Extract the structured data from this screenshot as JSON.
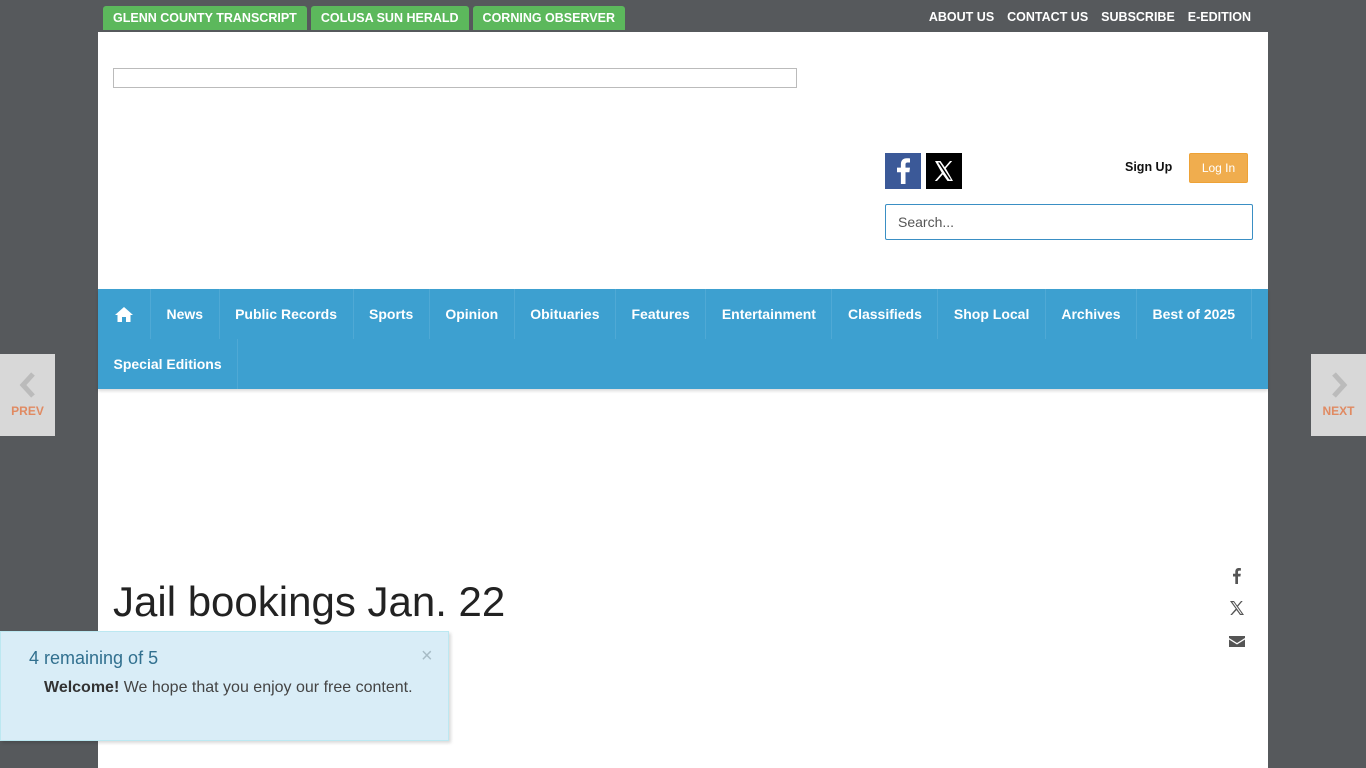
{
  "topbar": {
    "sister_sites": [
      "GLENN COUNTY TRANSCRIPT",
      "COLUSA SUN HERALD",
      "CORNING OBSERVER"
    ],
    "links": [
      "ABOUT US",
      "CONTACT US",
      "SUBSCRIBE",
      "E-EDITION"
    ]
  },
  "header": {
    "signup_label": "Sign Up",
    "login_label": "Log In",
    "search_placeholder": "Search..."
  },
  "nav": {
    "items": [
      "News",
      "Public Records",
      "Sports",
      "Opinion",
      "Obituaries",
      "Features",
      "Entertainment",
      "Classifieds",
      "Shop Local",
      "Archives",
      "Best of 2025"
    ],
    "items_row2": [
      "Special Editions"
    ]
  },
  "article": {
    "headline": "Jail bookings Jan. 22"
  },
  "side_nav": {
    "prev_label": "PREV",
    "next_label": "NEXT"
  },
  "notice": {
    "title": "4 remaining of 5",
    "close": "×",
    "welcome": "Welcome!",
    "message": " We hope that you enjoy our free content."
  },
  "colors": {
    "sister_site_bg": "#5cb85c",
    "nav_bg": "#3da0d0",
    "login_bg": "#f0ad4e",
    "notice_bg": "#d9edf7"
  }
}
